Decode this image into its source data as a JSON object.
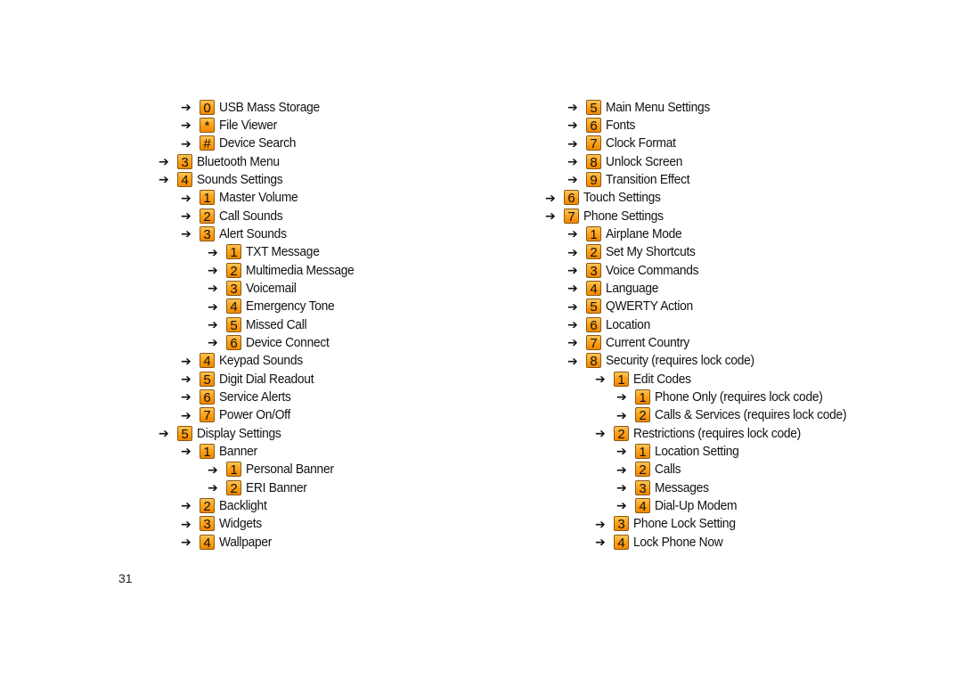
{
  "page_number": "31",
  "arrow_glyph": "➔",
  "left_column": [
    {
      "level": 1,
      "key": "0",
      "label": "USB Mass Storage"
    },
    {
      "level": 1,
      "key": "*",
      "label": "File Viewer"
    },
    {
      "level": 1,
      "key": "#",
      "label": "Device Search"
    },
    {
      "level": 0,
      "key": "3",
      "label": "Bluetooth Menu"
    },
    {
      "level": 0,
      "key": "4",
      "label": "Sounds Settings"
    },
    {
      "level": 1,
      "key": "1",
      "label": "Master Volume"
    },
    {
      "level": 1,
      "key": "2",
      "label": "Call Sounds"
    },
    {
      "level": 1,
      "key": "3",
      "label": "Alert Sounds"
    },
    {
      "level": 2,
      "key": "1",
      "label": "TXT Message"
    },
    {
      "level": 2,
      "key": "2",
      "label": "Multimedia Message"
    },
    {
      "level": 2,
      "key": "3",
      "label": "Voicemail"
    },
    {
      "level": 2,
      "key": "4",
      "label": "Emergency Tone"
    },
    {
      "level": 2,
      "key": "5",
      "label": "Missed Call"
    },
    {
      "level": 2,
      "key": "6",
      "label": "Device Connect"
    },
    {
      "level": 1,
      "key": "4",
      "label": "Keypad Sounds"
    },
    {
      "level": 1,
      "key": "5",
      "label": "Digit Dial Readout"
    },
    {
      "level": 1,
      "key": "6",
      "label": "Service Alerts"
    },
    {
      "level": 1,
      "key": "7",
      "label": "Power On/Off"
    },
    {
      "level": 0,
      "key": "5",
      "label": "Display Settings"
    },
    {
      "level": 1,
      "key": "1",
      "label": "Banner"
    },
    {
      "level": 2,
      "key": "1",
      "label": "Personal Banner"
    },
    {
      "level": 2,
      "key": "2",
      "label": "ERI Banner"
    },
    {
      "level": 1,
      "key": "2",
      "label": "Backlight"
    },
    {
      "level": 1,
      "key": "3",
      "label": "Widgets"
    },
    {
      "level": 1,
      "key": "4",
      "label": "Wallpaper"
    }
  ],
  "right_column": [
    {
      "level": 1,
      "key": "5",
      "label": "Main Menu Settings"
    },
    {
      "level": 1,
      "key": "6",
      "label": "Fonts"
    },
    {
      "level": 1,
      "key": "7",
      "label": "Clock Format"
    },
    {
      "level": 1,
      "key": "8",
      "label": "Unlock Screen"
    },
    {
      "level": 1,
      "key": "9",
      "label": "Transition Effect"
    },
    {
      "level": 0,
      "key": "6",
      "label": "Touch Settings"
    },
    {
      "level": 0,
      "key": "7",
      "label": "Phone Settings"
    },
    {
      "level": 1,
      "key": "1",
      "label": "Airplane Mode"
    },
    {
      "level": 1,
      "key": "2",
      "label": "Set My Shortcuts"
    },
    {
      "level": 1,
      "key": "3",
      "label": "Voice Commands"
    },
    {
      "level": 1,
      "key": "4",
      "label": "Language"
    },
    {
      "level": 1,
      "key": "5",
      "label": "QWERTY Action"
    },
    {
      "level": 1,
      "key": "6",
      "label": "Location"
    },
    {
      "level": 1,
      "key": "7",
      "label": "Current Country"
    },
    {
      "level": 1,
      "key": "8",
      "label": "Security (requires lock code)"
    },
    {
      "level": 2,
      "key": "1",
      "label": "Edit Codes"
    },
    {
      "level": 3,
      "key": "1",
      "label": "Phone Only (requires lock code)"
    },
    {
      "level": 3,
      "key": "2",
      "label": "Calls & Services (requires lock code)"
    },
    {
      "level": 2,
      "key": "2",
      "label": "Restrictions (requires lock code)"
    },
    {
      "level": 3,
      "key": "1",
      "label": "Location Setting"
    },
    {
      "level": 3,
      "key": "2",
      "label": "Calls"
    },
    {
      "level": 3,
      "key": "3",
      "label": "Messages"
    },
    {
      "level": 3,
      "key": "4",
      "label": "Dial-Up Modem"
    },
    {
      "level": 2,
      "key": "3",
      "label": "Phone Lock Setting"
    },
    {
      "level": 2,
      "key": "4",
      "label": "Lock Phone Now"
    }
  ],
  "colors": {
    "key_top": "#ffc555",
    "key_bottom": "#f18700",
    "key_border": "#8a5a14",
    "text": "#111111"
  }
}
